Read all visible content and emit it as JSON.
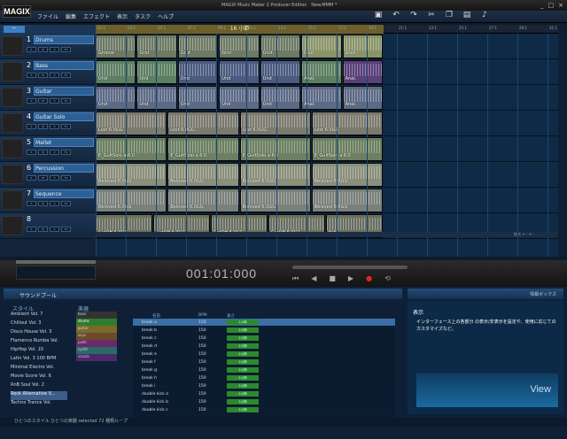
{
  "app": {
    "title": "MAGIX Music Maker 2 Producer Edition",
    "project": "New.MMM *",
    "logo": "MAGIX"
  },
  "menu": [
    "ファイル",
    "編集",
    "エフェクト",
    "表示",
    "タスク",
    "ヘルプ"
  ],
  "track_header_button": "ー",
  "tracks": [
    {
      "num": "1",
      "name": "Drums",
      "clips": [
        "Groove",
        "Grut",
        "Grut",
        "Grut",
        "Grut",
        "Grut",
        "Grut"
      ]
    },
    {
      "num": "2",
      "name": "Bass",
      "clips": [
        "Und",
        "Und",
        "Und",
        "Und",
        "Und",
        "Anal.",
        "Anal."
      ]
    },
    {
      "num": "3",
      "name": "Guitar",
      "clips": [
        "Und",
        "Und",
        "Und",
        "Und",
        "Und",
        "Anal.",
        "Anal."
      ]
    },
    {
      "num": "4",
      "name": "Guitar Solo",
      "clips": [
        "Lost 6.0GG",
        "Lost 6.0GG",
        "Lost 6.0GG",
        "Lost 6.0GG"
      ]
    },
    {
      "num": "5",
      "name": "Mallet",
      "clips": [
        "E_GuitSolo a 6.0",
        "E_GuitSolo a 6.0",
        "E_GuitSolo a 6.0",
        "E_GuitSolo a 6.0"
      ]
    },
    {
      "num": "6",
      "name": "Percussion",
      "clips": [
        "Beloved 6.0GG",
        "Beloved 6.0GG",
        "Beloved 6.0GG",
        "Beloved 6.0GG"
      ]
    },
    {
      "num": "7",
      "name": "Sequence",
      "clips": [
        "Beloved 6.0GG",
        "Beloved 6.0GG",
        "Beloved 6.0GG",
        "Beloved 6.0GG"
      ]
    },
    {
      "num": "8",
      "name": "",
      "clips": [
        "CutOff 6.0GG",
        "CutOff 6.0GG",
        "CutOff 6.0GG",
        "CutOff 6.0GG",
        "FxS"
      ]
    }
  ],
  "ruler": {
    "bar_label": "16 小節",
    "ticks": [
      "01:1",
      "03:1",
      "05:1",
      "07:1",
      "09:1",
      "11:1",
      "13:1",
      "15:1",
      "17:1",
      "19:1",
      "21:1",
      "23:1",
      "25:1",
      "27:1",
      "29:1",
      "31:1"
    ]
  },
  "transport": {
    "time": "001:01:000"
  },
  "zoom": {
    "label": "拡大"
  },
  "pool": {
    "title": "サウンドプール",
    "style_label": "スタイル",
    "instrument_label": "楽器",
    "styles": [
      "Ambient Vol. 7",
      "Chillout Vol. 3",
      "Disco House Vol. 3",
      "Flamenco Rumba Vol.",
      "HipHop Vol. 10",
      "Latin Vol. 3 100 BPM",
      "Minimal Electro Vol.",
      "Movie Score Vol. 6",
      "RnB Soul Vol. 2",
      "Rock Alternative V...",
      "Techno Trance Vol."
    ],
    "instruments": [
      "bass",
      "drums",
      "guitar",
      "keys",
      "pads",
      "synth",
      "vocals"
    ],
    "columns": [
      "名前",
      "BPM",
      "長さ"
    ],
    "loops": [
      {
        "name": "break a",
        "bpm": "150",
        "len": "1小節"
      },
      {
        "name": "break b",
        "bpm": "150",
        "len": "1小節"
      },
      {
        "name": "break c",
        "bpm": "150",
        "len": "1小節"
      },
      {
        "name": "break d",
        "bpm": "150",
        "len": "1小節"
      },
      {
        "name": "break e",
        "bpm": "150",
        "len": "1小節"
      },
      {
        "name": "break f",
        "bpm": "150",
        "len": "1小節"
      },
      {
        "name": "break g",
        "bpm": "150",
        "len": "1小節"
      },
      {
        "name": "break h",
        "bpm": "150",
        "len": "1小節"
      },
      {
        "name": "break i",
        "bpm": "150",
        "len": "1小節"
      },
      {
        "name": "double kick a",
        "bpm": "150",
        "len": "1小節"
      },
      {
        "name": "double kick b",
        "bpm": "150",
        "len": "1小節"
      },
      {
        "name": "double kick c",
        "bpm": "150",
        "len": "1小節"
      }
    ]
  },
  "info": {
    "title": "情報ボックス",
    "heading": "表示",
    "text": "インターフェース上の各部分 の表示/非表示を設定や、使用に応じてのカスタマイズなど。",
    "view": "View"
  },
  "status": "ひとつのスタイル ひとつの楽器 selected 72 種類ループ"
}
